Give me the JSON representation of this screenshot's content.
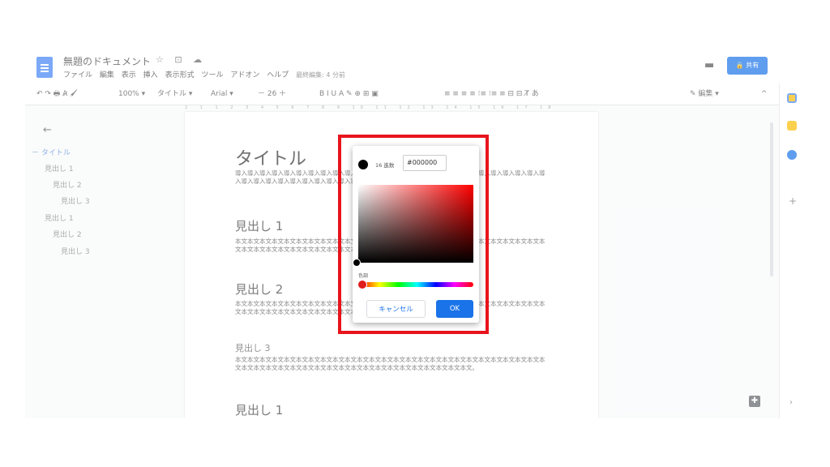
{
  "app": {
    "doc_title": "無題のドキュメント",
    "title_icons": "☆ ⊡ ☁",
    "menus": [
      "ファイル",
      "編集",
      "表示",
      "挿入",
      "表示形式",
      "ツール",
      "アドオン",
      "ヘルプ"
    ],
    "last_edit": "最終編集: 4 分前",
    "share_label": "🔒 共有",
    "comment_icon": "comment-icon"
  },
  "toolbar": {
    "undo": "↶ ↷ 🖶 A̷ 🖌",
    "zoom": "100% ▾",
    "style": "タイトル ▾",
    "font": "Arial ▾",
    "size": "－ 26 ＋",
    "format": "B I U A ✎ ⊕ ⊞ ▣",
    "align": "≡ ≡ ≡ ≡ ⁝≡ ⁝≡ ≡ ⊟ ⊟ T̸ あ",
    "mode": "✎ 編集 ▾",
    "collapse": "^"
  },
  "ruler": "2 1 1 2 3 4 5 6 7 8 9 10 11 12 13 14 15 16 17 18",
  "outline": {
    "back": "←",
    "items": [
      "－ タイトル",
      "見出し 1",
      "見出し 2",
      "見出し 3",
      "見出し 1",
      "見出し 2",
      "見出し 3"
    ]
  },
  "page": {
    "title": "タイトル",
    "title_body": "導入導入導入導入導入導入導入導入導入導入導入導入導入導入導入導入導入導入導入導入導入導入導入導入導入導入導入導入導入導入導入導入導入導入導入導入導入導入導入導入導入導入導入。",
    "h1_a": "見出し 1",
    "body_a": "本文本文本文本文本文本文本文本文本文本文本文本文本文本文本文本文本文本文本文本文本文本文本文本文本文本文本文本文本文本文本文本文本文本文本文本文本文本文本文本文本文本文本文本文本文。",
    "h2": "見出し 2",
    "body_b": "本文本文本文本文本文本文本文本文本文本文本文本文本文本文本文本文本文本文本文本文本文本文本文本文本文本文本文本文本文本文本文本文本文本文本文本文本文本文本文本文本文本文本文本文本文。",
    "h3": "見出し 3",
    "body_c": "本文本文本文本文本文本文本文本文本文本文本文本文本文本文本文本文本文本文本文本文本文本文本文本文本文本文本文本文本文本文本文本文本文本文本文本文本文本文本文本文本文本文本文本文本文。",
    "h1_b": "見出し 1"
  },
  "color_dialog": {
    "hex_label": "16 進数",
    "hex_value": "#000000",
    "selected_color": "#000000",
    "hue_label": "色調",
    "cancel_label": "キャンセル",
    "ok_label": "OK"
  },
  "colors": {
    "accent": "#1a73e8",
    "highlight": "#e8141c"
  }
}
